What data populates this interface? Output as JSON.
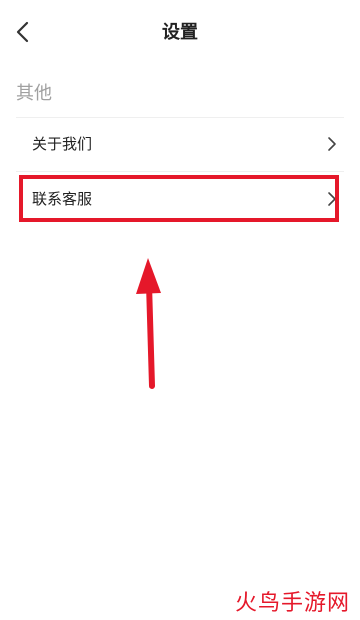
{
  "nav": {
    "title": "设置",
    "back_icon": "chevron-left-icon"
  },
  "section": {
    "header": "其他",
    "items": [
      {
        "label": "关于我们",
        "icon": "chevron-right-icon"
      },
      {
        "label": "联系客服",
        "icon": "chevron-right-icon"
      }
    ]
  },
  "annotation": {
    "highlight_color": "#e5182a",
    "watermark": "火鸟手游网"
  }
}
